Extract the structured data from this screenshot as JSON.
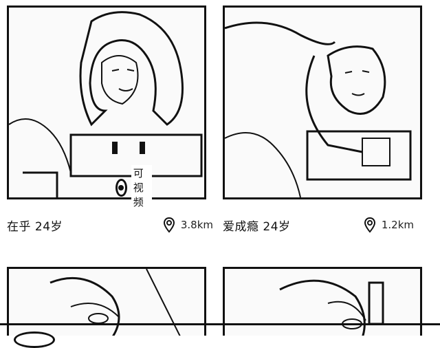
{
  "cards": [
    {
      "name": "在乎 24岁",
      "distance": "3.8km",
      "video_badge": "可视频",
      "pin_icon": "location-pin-icon"
    },
    {
      "name": "爱成瘾 24岁",
      "distance": "1.2km",
      "pin_icon": "location-pin-icon"
    }
  ],
  "colors": {
    "ink": "#111111",
    "background": "#ffffff"
  }
}
